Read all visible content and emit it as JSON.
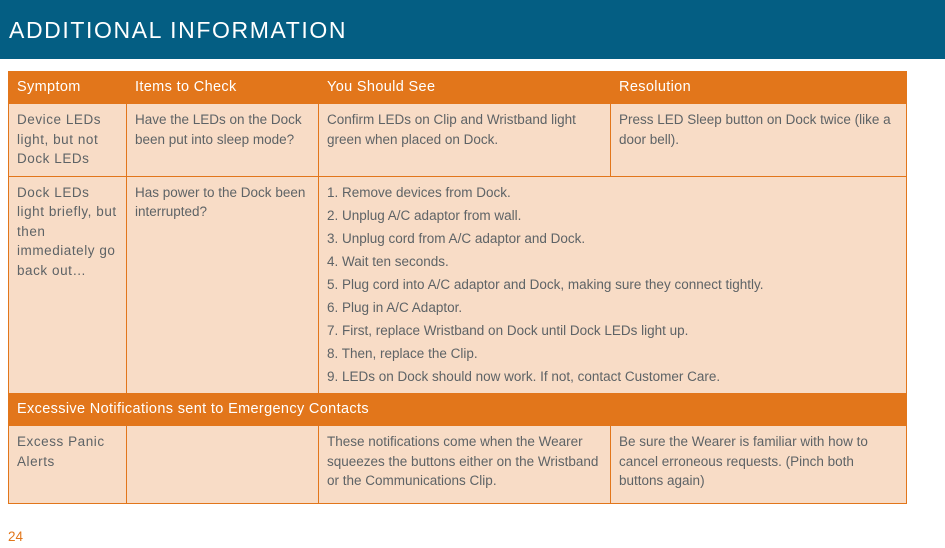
{
  "banner": {
    "title": "ADDITIONAL INFORMATION",
    "background_color": "#045E83",
    "text_color": "#FFFFFF"
  },
  "theme": {
    "accent_orange": "#E2761B",
    "cell_fill": "#F8DCC6",
    "body_text": "#5E6366"
  },
  "table": {
    "columns": [
      {
        "label": "Symptom"
      },
      {
        "label": "Items to Check"
      },
      {
        "label": "You Should  See"
      },
      {
        "label": "Resolution"
      }
    ],
    "rows": [
      {
        "type": "data",
        "symptom": "Device  LEDs light,  but  not Dock  LEDs",
        "items_to_check": "Have the LEDs on the Dock been put into sleep mode?",
        "you_should_see": "Confirm LEDs on Clip and Wristband light green when placed on Dock.",
        "resolution": "Press LED Sleep button on Dock twice (like a door bell)."
      },
      {
        "type": "data-merged",
        "symptom": "Dock  LEDs light  briefly, but  then immediately go back  out…",
        "items_to_check": "Has power to the Dock been interrupted?",
        "steps": [
          "1. Remove devices from Dock.",
          "2. Unplug A/C adaptor from wall.",
          "3. Unplug cord from A/C adaptor and Dock.",
          "4. Wait ten seconds.",
          "5. Plug cord into A/C adaptor and Dock, making sure they connect tightly.",
          "6. Plug in A/C Adaptor.",
          "7. First, replace Wristband on Dock until Dock LEDs light up.",
          "8. Then, replace the Clip.",
          "9. LEDs on Dock should now work. If not, contact Customer Care."
        ]
      },
      {
        "type": "section",
        "label": "Excessive  Notifications sent  to Emergency  Contacts"
      },
      {
        "type": "data",
        "symptom": "Excess  Panic Alerts",
        "items_to_check": "",
        "you_should_see": "These notifications come when the Wearer squeezes the buttons either on the Wristband or the Communications Clip.",
        "resolution": "Be sure the Wearer is familiar with how to cancel erroneous requests. (Pinch both buttons again)"
      }
    ]
  },
  "footer": {
    "page_number": "24"
  }
}
